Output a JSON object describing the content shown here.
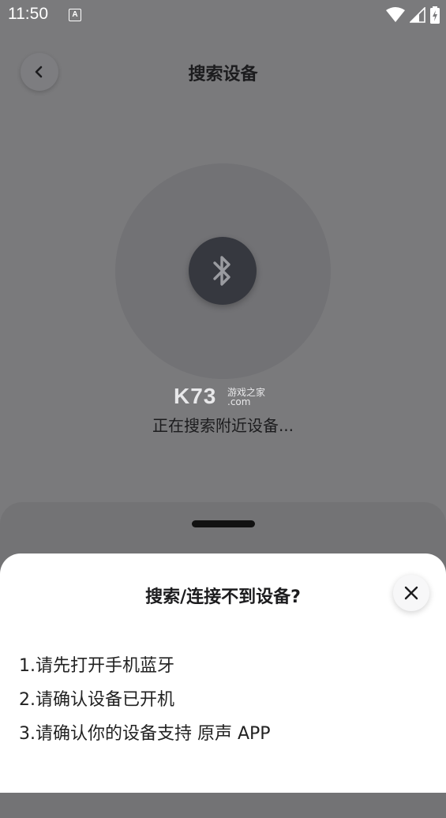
{
  "status_bar": {
    "time": "11:50",
    "notification_icon": "A"
  },
  "header": {
    "title": "搜索设备",
    "back_icon": "chevron-left-icon"
  },
  "scan": {
    "status_text": "正在搜索附近设备...",
    "icon": "bluetooth-icon"
  },
  "watermark": {
    "brand": "K73",
    "subtitle": "游戏之家",
    "domain": ".com"
  },
  "dialog": {
    "title": "搜索/连接不到设备?",
    "close_icon": "close-icon",
    "tips": [
      "1.请先打开手机蓝牙",
      "2.请确认设备已开机",
      "3.请确认你的设备支持 原声 APP"
    ]
  },
  "colors": {
    "overlay": "#7a7a7c",
    "bluetooth_circle": "#36383f",
    "dialog_bg": "#ffffff"
  }
}
